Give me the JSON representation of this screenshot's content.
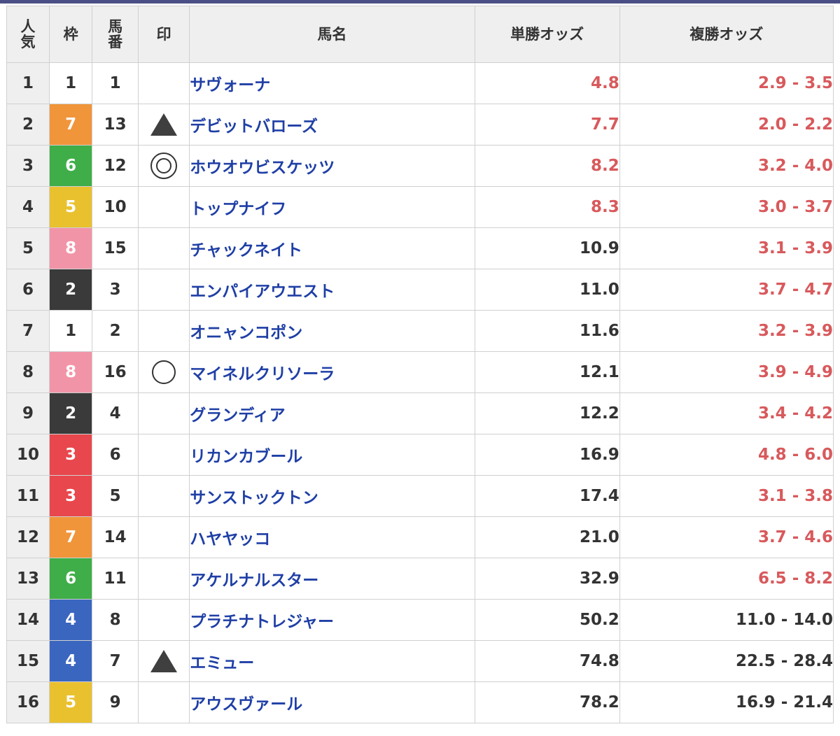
{
  "headers": {
    "popularity": [
      "人",
      "気"
    ],
    "waku": "枠",
    "number": [
      "馬",
      "番"
    ],
    "mark": "印",
    "name": "馬名",
    "win": "単勝オッズ",
    "place": "複勝オッズ"
  },
  "colors": {
    "accent_bar": "#4a4f86",
    "odds_red": "#d8595c",
    "name_blue": "#1f3fa6",
    "waku": {
      "1": {
        "bg": "#ffffff",
        "fg": "#333333"
      },
      "2": {
        "bg": "#3a3a3a",
        "fg": "#ffffff"
      },
      "3": {
        "bg": "#e8474d",
        "fg": "#ffffff"
      },
      "4": {
        "bg": "#3b66c0",
        "fg": "#ffffff"
      },
      "5": {
        "bg": "#e9c12f",
        "fg": "#ffffff"
      },
      "6": {
        "bg": "#3fae48",
        "fg": "#ffffff"
      },
      "7": {
        "bg": "#f0953a",
        "fg": "#ffffff"
      },
      "8": {
        "bg": "#f294a8",
        "fg": "#ffffff"
      }
    }
  },
  "rows": [
    {
      "pop": "1",
      "waku": "1",
      "num": "1",
      "mark": "",
      "name": "サヴォーナ",
      "win": "4.8",
      "place": "2.9 - 3.5",
      "win_red": true,
      "place_red": true
    },
    {
      "pop": "2",
      "waku": "7",
      "num": "13",
      "mark": "triangle",
      "name": "デビットバローズ",
      "win": "7.7",
      "place": "2.0 - 2.2",
      "win_red": true,
      "place_red": true
    },
    {
      "pop": "3",
      "waku": "6",
      "num": "12",
      "mark": "double-circle",
      "name": "ホウオウビスケッツ",
      "win": "8.2",
      "place": "3.2 - 4.0",
      "win_red": true,
      "place_red": true
    },
    {
      "pop": "4",
      "waku": "5",
      "num": "10",
      "mark": "",
      "name": "トップナイフ",
      "win": "8.3",
      "place": "3.0 - 3.7",
      "win_red": true,
      "place_red": true
    },
    {
      "pop": "5",
      "waku": "8",
      "num": "15",
      "mark": "",
      "name": "チャックネイト",
      "win": "10.9",
      "place": "3.1 - 3.9",
      "win_red": false,
      "place_red": true
    },
    {
      "pop": "6",
      "waku": "2",
      "num": "3",
      "mark": "",
      "name": "エンパイアウエスト",
      "win": "11.0",
      "place": "3.7 - 4.7",
      "win_red": false,
      "place_red": true
    },
    {
      "pop": "7",
      "waku": "1",
      "num": "2",
      "mark": "",
      "name": "オニャンコポン",
      "win": "11.6",
      "place": "3.2 - 3.9",
      "win_red": false,
      "place_red": true
    },
    {
      "pop": "8",
      "waku": "8",
      "num": "16",
      "mark": "circle",
      "name": "マイネルクリソーラ",
      "win": "12.1",
      "place": "3.9 - 4.9",
      "win_red": false,
      "place_red": true
    },
    {
      "pop": "9",
      "waku": "2",
      "num": "4",
      "mark": "",
      "name": "グランディア",
      "win": "12.2",
      "place": "3.4 - 4.2",
      "win_red": false,
      "place_red": true
    },
    {
      "pop": "10",
      "waku": "3",
      "num": "6",
      "mark": "",
      "name": "リカンカブール",
      "win": "16.9",
      "place": "4.8 - 6.0",
      "win_red": false,
      "place_red": true
    },
    {
      "pop": "11",
      "waku": "3",
      "num": "5",
      "mark": "",
      "name": "サンストックトン",
      "win": "17.4",
      "place": "3.1 - 3.8",
      "win_red": false,
      "place_red": true
    },
    {
      "pop": "12",
      "waku": "7",
      "num": "14",
      "mark": "",
      "name": "ハヤヤッコ",
      "win": "21.0",
      "place": "3.7 - 4.6",
      "win_red": false,
      "place_red": true
    },
    {
      "pop": "13",
      "waku": "6",
      "num": "11",
      "mark": "",
      "name": "アケルナルスター",
      "win": "32.9",
      "place": "6.5 - 8.2",
      "win_red": false,
      "place_red": true
    },
    {
      "pop": "14",
      "waku": "4",
      "num": "8",
      "mark": "",
      "name": "プラチナトレジャー",
      "win": "50.2",
      "place": "11.0 - 14.0",
      "win_red": false,
      "place_red": false
    },
    {
      "pop": "15",
      "waku": "4",
      "num": "7",
      "mark": "triangle",
      "name": "エミュー",
      "win": "74.8",
      "place": "22.5 - 28.4",
      "win_red": false,
      "place_red": false
    },
    {
      "pop": "16",
      "waku": "5",
      "num": "9",
      "mark": "",
      "name": "アウスヴァール",
      "win": "78.2",
      "place": "16.9 - 21.4",
      "win_red": false,
      "place_red": false
    }
  ]
}
